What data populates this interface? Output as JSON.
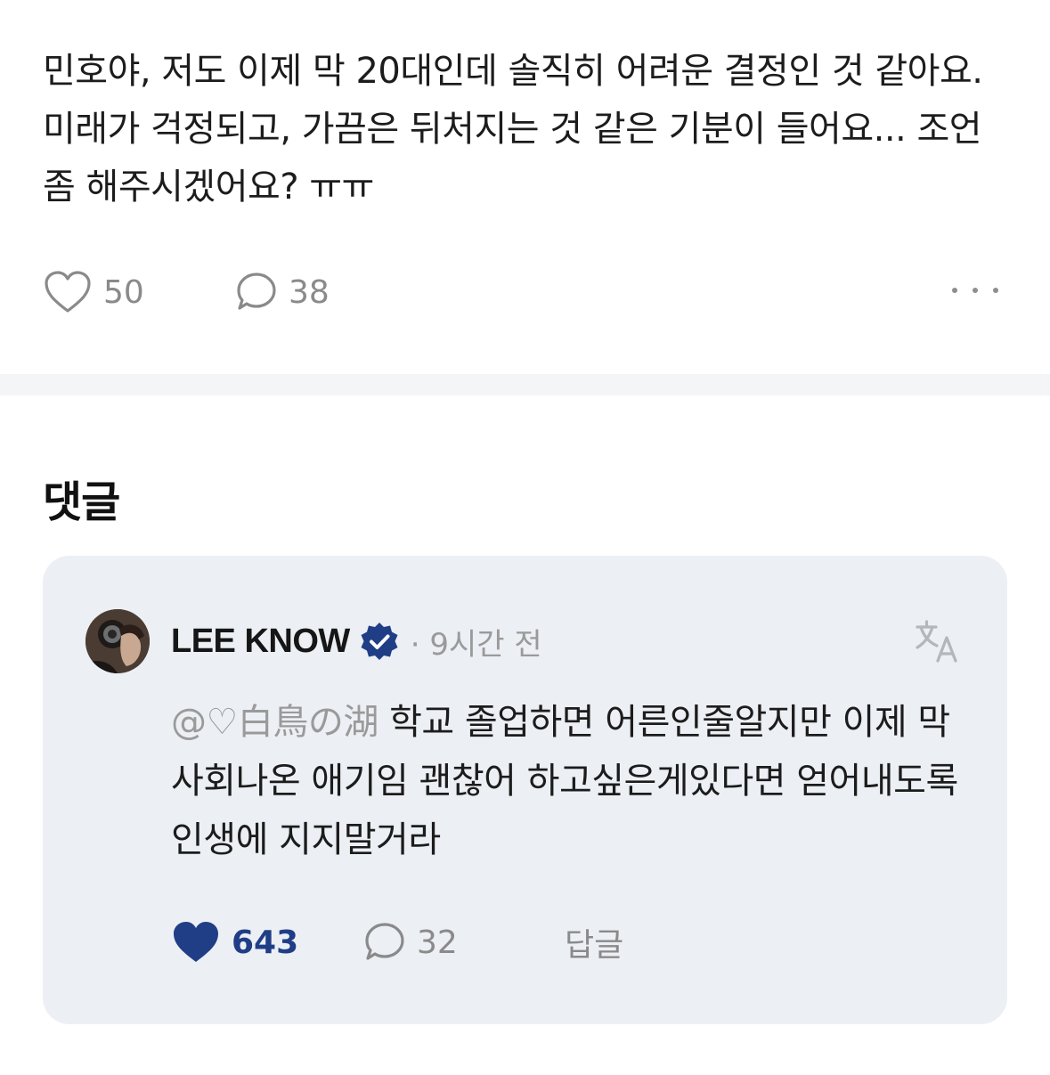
{
  "post": {
    "text": "민호야, 저도 이제 막 20대인데 솔직히 어려운 결정인 것 같아요. 미래가 걱정되고, 가끔은 뒤처지는 것 같은 기분이 들어요... 조언 좀 해주시겠어요? ㅠㅠ",
    "likes": "50",
    "comments": "38",
    "icons": {
      "like": "heart-outline-icon",
      "comment": "speech-bubble-icon",
      "more": "more-horizontal-icon"
    }
  },
  "comments_section": {
    "heading": "댓글",
    "comment": {
      "author": "LEE KNOW",
      "verified": true,
      "time": "· 9시간 전",
      "mention": "@♡白鳥の湖",
      "text": " 학교 졸업하면 어른인줄알지만 이제 막사회나온 애기임 괜찮어 하고싶은게있다면 얻어내도록 인생에 지지말거라",
      "likes": "643",
      "liked": true,
      "replies": "32",
      "reply_label": "답글",
      "icons": {
        "like": "heart-filled-icon",
        "comment": "speech-bubble-icon",
        "translate": "translate-icon",
        "verified": "verified-badge-icon"
      },
      "colors": {
        "accent": "#1f3e86",
        "card_background": "#eceff4"
      }
    }
  }
}
